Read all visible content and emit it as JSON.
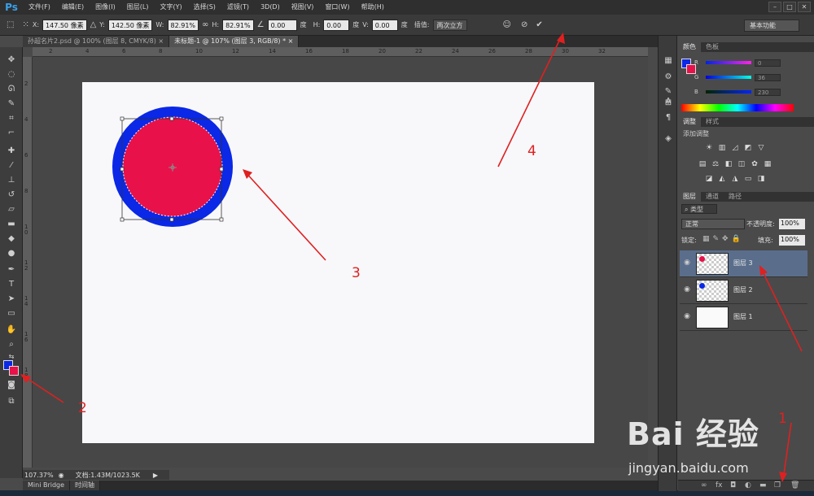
{
  "app": {
    "logo": "Ps"
  },
  "menu": [
    "文件(F)",
    "编辑(E)",
    "图像(I)",
    "图层(L)",
    "文字(Y)",
    "选择(S)",
    "滤镜(T)",
    "3D(D)",
    "视图(V)",
    "窗口(W)",
    "帮助(H)"
  ],
  "window_controls": {
    "min": "–",
    "max": "□",
    "close": "✕"
  },
  "options": {
    "x_label": "X:",
    "x_value": "147.50 像素",
    "y_label": "Y:",
    "y_value": "142.50 像素",
    "w_label": "W:",
    "w_value": "82.91%",
    "h_label": "H:",
    "h_value": "82.91%",
    "angle_value": "0.00",
    "angle_unit": "度",
    "hskew_label": "H:",
    "hskew_value": "0.00",
    "hskew_unit": "度",
    "vskew_label": "V:",
    "vskew_value": "0.00",
    "vskew_unit": "度",
    "interp_label": "插值:",
    "interp_value": "两次立方",
    "workspace": "基本功能"
  },
  "tabs": [
    {
      "label": "孙超名片2.psd @ 100% (图层 8, CMYK/8)",
      "close": "×"
    },
    {
      "label": "未标题-1 @ 107% (图层 3, RGB/8) *",
      "close": "×"
    }
  ],
  "ruler_top": [
    "2",
    "4",
    "6",
    "8",
    "10",
    "12",
    "14",
    "16",
    "18",
    "20",
    "22",
    "24",
    "26",
    "28",
    "30",
    "32"
  ],
  "ruler_left": [
    "2",
    "4",
    "6",
    "8",
    "1 0",
    "1 2",
    "1 4",
    "1 6",
    "1 8"
  ],
  "status": {
    "zoom": "107.37%",
    "doc": "文档:1.43M/1023.5K"
  },
  "bottom_tabs": [
    "Mini Bridge",
    "时间轴"
  ],
  "color_panel": {
    "tabs": [
      "颜色",
      "色板"
    ],
    "channels": [
      {
        "letter": "R",
        "value": "0"
      },
      {
        "letter": "G",
        "value": "36"
      },
      {
        "letter": "B",
        "value": "230"
      }
    ],
    "colors": {
      "foreground": "#0a28e6",
      "background": "#e8114a"
    }
  },
  "adjust_panel": {
    "tabs": [
      "调整",
      "样式"
    ],
    "title": "添加调整"
  },
  "layers_panel": {
    "tabs": [
      "图层",
      "通道",
      "路径"
    ],
    "filter": "类型",
    "blend_mode": "正常",
    "opacity_label": "不透明度:",
    "opacity_value": "100%",
    "lock_label": "锁定:",
    "fill_label": "填充:",
    "fill_value": "100%",
    "layers": [
      {
        "name": "图层 3",
        "dot": "#e8114a",
        "selected": true
      },
      {
        "name": "图层 2",
        "dot": "#0a28e6",
        "selected": false
      },
      {
        "name": "图层 1",
        "dot": "",
        "selected": false
      }
    ]
  },
  "annotations": [
    "1",
    "2",
    "3",
    "4"
  ],
  "watermark": {
    "main": "Bai 经验",
    "url": "jingyan.baidu.com"
  }
}
